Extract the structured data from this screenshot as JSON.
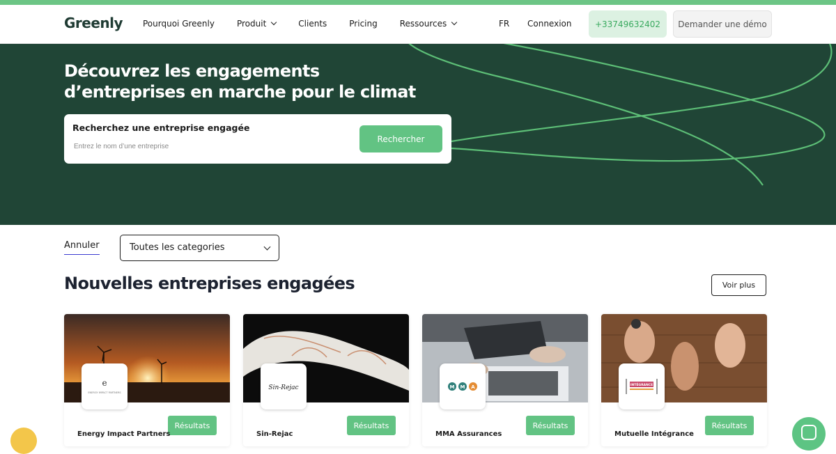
{
  "header": {
    "logo": "Greenly",
    "nav": [
      {
        "label": "Pourquoi Greenly",
        "has_dropdown": false
      },
      {
        "label": "Produit",
        "has_dropdown": true
      },
      {
        "label": "Clients",
        "has_dropdown": false
      },
      {
        "label": "Pricing",
        "has_dropdown": false
      },
      {
        "label": "Ressources",
        "has_dropdown": true
      }
    ],
    "language": "FR",
    "login": "Connexion",
    "phone": "+33749632402",
    "demo": "Demander une démo"
  },
  "hero": {
    "title": "Découvrez les engagements d’entreprises en marche pour le climat",
    "search_label": "Recherchez une entreprise engagée",
    "search_placeholder": "Entrez le nom d’une entreprise",
    "search_button": "Rechercher"
  },
  "filters": {
    "cancel": "Annuler",
    "category_selected": "Toutes les categories"
  },
  "section": {
    "title": "Nouvelles entreprises engagées",
    "more_button": "Voir plus"
  },
  "cards": [
    {
      "name": "Energy Impact Partners",
      "button": "Résultats",
      "logo_text": "e"
    },
    {
      "name": "Sin-Rejac",
      "button": "Résultats",
      "logo_text": "Sin-Rejac"
    },
    {
      "name": "MMA Assurances",
      "button": "Résultats",
      "logo_text": "MMA"
    },
    {
      "name": "Mutuelle Intégrance",
      "button": "Résultats",
      "logo_text": "INTÉGRANCE"
    }
  ],
  "colors": {
    "brand_green": "#62c383",
    "hero_bg": "#204536",
    "top_bar": "#6cc585"
  }
}
